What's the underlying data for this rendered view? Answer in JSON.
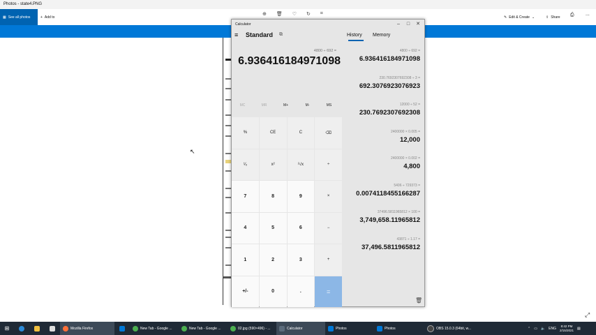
{
  "photos": {
    "window_title": "Photos - state4.PNG",
    "see_all": "See all photos",
    "add_to": "Add to",
    "edit_create": "Edit & Create",
    "share": "Share",
    "more": "..."
  },
  "calculator": {
    "window_title": "Calculator",
    "mode": "Standard",
    "tabs": {
      "history": "History",
      "memory": "Memory"
    },
    "expression": "4800 ÷ 692 =",
    "display": "6.936416184971098",
    "memory_buttons": [
      "MC",
      "MR",
      "M+",
      "M-",
      "MS"
    ],
    "keys": [
      "%",
      "CE",
      "C",
      "⌫",
      "¹⁄ₓ",
      "x²",
      "²√x",
      "÷",
      "7",
      "8",
      "9",
      "×",
      "4",
      "5",
      "6",
      "−",
      "1",
      "2",
      "3",
      "+",
      "+/-",
      "0",
      ".",
      "="
    ],
    "history": [
      {
        "expr": "4800  ÷  692 =",
        "result": "6.936416184971098"
      },
      {
        "expr": "230.7692307692308  ÷  3 =",
        "result": "692.3076923076923"
      },
      {
        "expr": "12000  ÷  52 =",
        "result": "230.7692307692308"
      },
      {
        "expr": "2400000  ×  0.005 =",
        "result": "12,000"
      },
      {
        "expr": "2400000  ×  0.002 =",
        "result": "4,800"
      },
      {
        "expr": "5406  ÷  729373 =",
        "result": "0.0074118455166287"
      },
      {
        "expr": "37496.5811965812  ×  100 =",
        "result": "3,749,658.11965812"
      },
      {
        "expr": "43871  ÷  1.17 =",
        "result": "37,496.5811965812"
      }
    ]
  },
  "taskbar": {
    "items": [
      {
        "label": "Mozilla Firefox",
        "color": "#ff7139"
      },
      {
        "label": "New Tab - Google ...",
        "color": "#4caf50"
      },
      {
        "label": "New Tab - Google ...",
        "color": "#4caf50"
      },
      {
        "label": "02.jpg (590×496) - ...",
        "color": "#4caf50"
      },
      {
        "label": "Calculator",
        "color": "#5b6b7b"
      },
      {
        "label": "Photos",
        "color": "#0078d7"
      },
      {
        "label": "Photos",
        "color": "#0078d7"
      },
      {
        "label": "OBS 15.0.3 (64bit, w...",
        "color": "#444444"
      }
    ],
    "lang": "ENG",
    "time": "8:42 PM",
    "date": "2/15/2021"
  }
}
